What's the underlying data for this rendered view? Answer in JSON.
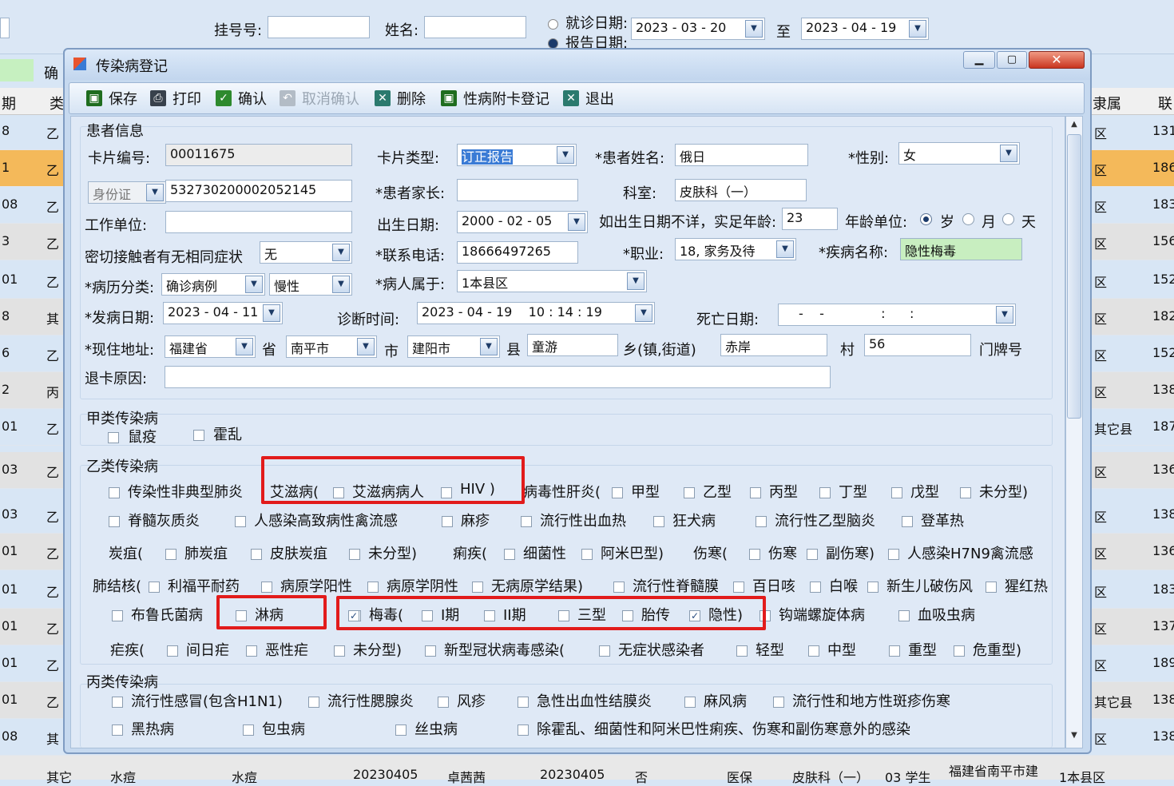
{
  "search": {
    "gh_label": "挂号号:",
    "name_label": "姓名:",
    "visit_date_label": "就诊日期:",
    "report_date_label": "报告日期:",
    "date_from": "2023 - 03 - 20",
    "to_label": "至",
    "date_to": "2023 - 04 - 19"
  },
  "bg_table": {
    "col_qi": "期",
    "col_lei": "类",
    "col_li": "隶属",
    "col_lian": "联",
    "rows": [
      {
        "a": "8",
        "b": "乙",
        "c": "区",
        "d": "131"
      },
      {
        "a": "1",
        "b": "乙",
        "c": "区",
        "d": "186"
      },
      {
        "a": "08",
        "b": "乙",
        "c": "区",
        "d": "183"
      },
      {
        "a": "3",
        "b": "乙",
        "c": "区",
        "d": "156"
      },
      {
        "a": "01",
        "b": "乙",
        "c": "区",
        "d": "152"
      },
      {
        "a": "8",
        "b": "其",
        "c": "区",
        "d": "182"
      },
      {
        "a": "6",
        "b": "乙",
        "c": "区",
        "d": "152"
      },
      {
        "a": "2",
        "b": "丙",
        "c": "区",
        "d": "138"
      },
      {
        "a": "01",
        "b": "乙",
        "c": "其它县",
        "d": "187"
      },
      {
        "a": "03",
        "b": "乙",
        "c": "区",
        "d": "136"
      },
      {
        "a": "03",
        "b": "乙",
        "c": "区",
        "d": "138"
      },
      {
        "a": "01",
        "b": "乙",
        "c": "区",
        "d": "136"
      },
      {
        "a": "01",
        "b": "乙",
        "c": "区",
        "d": "183"
      },
      {
        "a": "01",
        "b": "乙",
        "c": "区",
        "d": "137"
      },
      {
        "a": "01",
        "b": "乙",
        "c": "区",
        "d": "189"
      },
      {
        "a": "01",
        "b": "乙",
        "c": "其它县",
        "d": "138"
      },
      {
        "a": "08",
        "b": "其",
        "c": "区",
        "d": "138"
      }
    ],
    "bottom_row": [
      "其它",
      "水痘",
      "水痘",
      "20230405",
      "卓茜茜",
      "20230405",
      "否",
      "医保",
      "皮肤科（一）",
      "03 学生",
      "福建省南平市建",
      "1本县区"
    ]
  },
  "bg_left_label": "确",
  "dialog": {
    "title": "传染病登记",
    "toolbar": {
      "save": "保存",
      "print": "打印",
      "confirm": "确认",
      "cancel_confirm": "取消确认",
      "delete": "删除",
      "std_card": "性病附卡登记",
      "exit": "退出"
    },
    "patient": {
      "section": "患者信息",
      "card_no_label": "卡片编号:",
      "card_no": "00011675",
      "card_type_label": "卡片类型:",
      "card_type": "订正报告",
      "name_label": "*患者姓名:",
      "name": "俄日",
      "sex_label": "*性别:",
      "sex": "女",
      "id_type": "身份证",
      "id_no": "532730200002052145",
      "guardian_label": "*患者家长:",
      "guardian": "",
      "dept_label": "科室:",
      "dept": "皮肤科（一）",
      "work_label": "工作单位:",
      "work": "",
      "birth_label": "出生日期:",
      "birth": "2000 - 02 - 05",
      "age_hint_label": "如出生日期不详，实足年龄:",
      "age": "23",
      "age_unit_label": "年龄单位:",
      "unit_year": "岁",
      "unit_month": "月",
      "unit_day": "天",
      "contact_label": "密切接触者有无相同症状",
      "contact": "无",
      "phone_label": "*联系电话:",
      "phone": "18666497265",
      "job_label": "*职业:",
      "job": "18, 家务及待",
      "disease_label": "*疾病名称:",
      "disease": "隐性梅毒",
      "case_label": "*病历分类:",
      "case_type": "确诊病例",
      "case_sub": "慢性",
      "belong_label": "*病人属于:",
      "belong": "1本县区",
      "onset_label": "*发病日期:",
      "onset": "2023 - 04 - 11",
      "diag_label": "诊断时间:",
      "diag": "2023 - 04 - 19    10 : 14 : 19",
      "death_label": "死亡日期:",
      "death": "-    -              :      :",
      "addr_label": "*现住地址:",
      "province": "福建省",
      "sheng": "省",
      "city": "南平市",
      "shi": "市",
      "county": "建阳市",
      "xian": "县",
      "town": "童游",
      "xiang": "乡(镇,街道)",
      "village": "赤岸",
      "cun": "村",
      "door": "56",
      "menpai": "门牌号",
      "reject_label": "退卡原因:",
      "reject": ""
    },
    "classA": {
      "title": "甲类传染病",
      "items": [
        "鼠疫",
        "霍乱"
      ]
    },
    "classB": {
      "title": "乙类传染病",
      "r1": [
        "传染性非典型肺炎",
        "艾滋病(",
        "艾滋病病人",
        "HIV )",
        "病毒性肝炎(",
        "甲型",
        "乙型",
        "丙型",
        "丁型",
        "戊型",
        "未分型)"
      ],
      "r2": [
        "脊髓灰质炎",
        "人感染高致病性禽流感",
        "麻疹",
        "流行性出血热",
        "狂犬病",
        "流行性乙型脑炎",
        "登革热"
      ],
      "r3": [
        "炭疽(",
        "肺炭疽",
        "皮肤炭疽",
        "未分型)",
        "痢疾(",
        "细菌性",
        "阿米巴型)",
        "伤寒(",
        "伤寒",
        "副伤寒)",
        "人感染H7N9禽流感"
      ],
      "r4": [
        "肺结核(",
        "利福平耐药",
        "病原学阳性",
        "病原学阴性",
        "无病原学结果)",
        "流行性脊髓膜",
        "百日咳",
        "白喉",
        "新生儿破伤风",
        "猩红热"
      ],
      "r5": [
        "布鲁氏菌病",
        "淋病",
        "梅毒(",
        "I期",
        "II期",
        "三型",
        "胎传",
        "隐性)",
        "钩端螺旋体病",
        "血吸虫病"
      ],
      "r6": [
        "疟疾(",
        "间日疟",
        "恶性疟",
        "未分型)",
        "新型冠状病毒感染(",
        "无症状感染者",
        "轻型",
        "中型",
        "重型",
        "危重型)"
      ]
    },
    "classC": {
      "title": "丙类传染病",
      "r1": [
        "流行性感冒(包含H1N1)",
        "流行性腮腺炎",
        "风疹",
        "急性出血性结膜炎",
        "麻风病",
        "流行性和地方性斑疹伤寒"
      ],
      "r2": [
        "黑热病",
        "包虫病",
        "丝虫病",
        "除霍乱、细菌性和阿米巴性痢疾、伤寒和副伤寒意外的感染"
      ]
    }
  }
}
